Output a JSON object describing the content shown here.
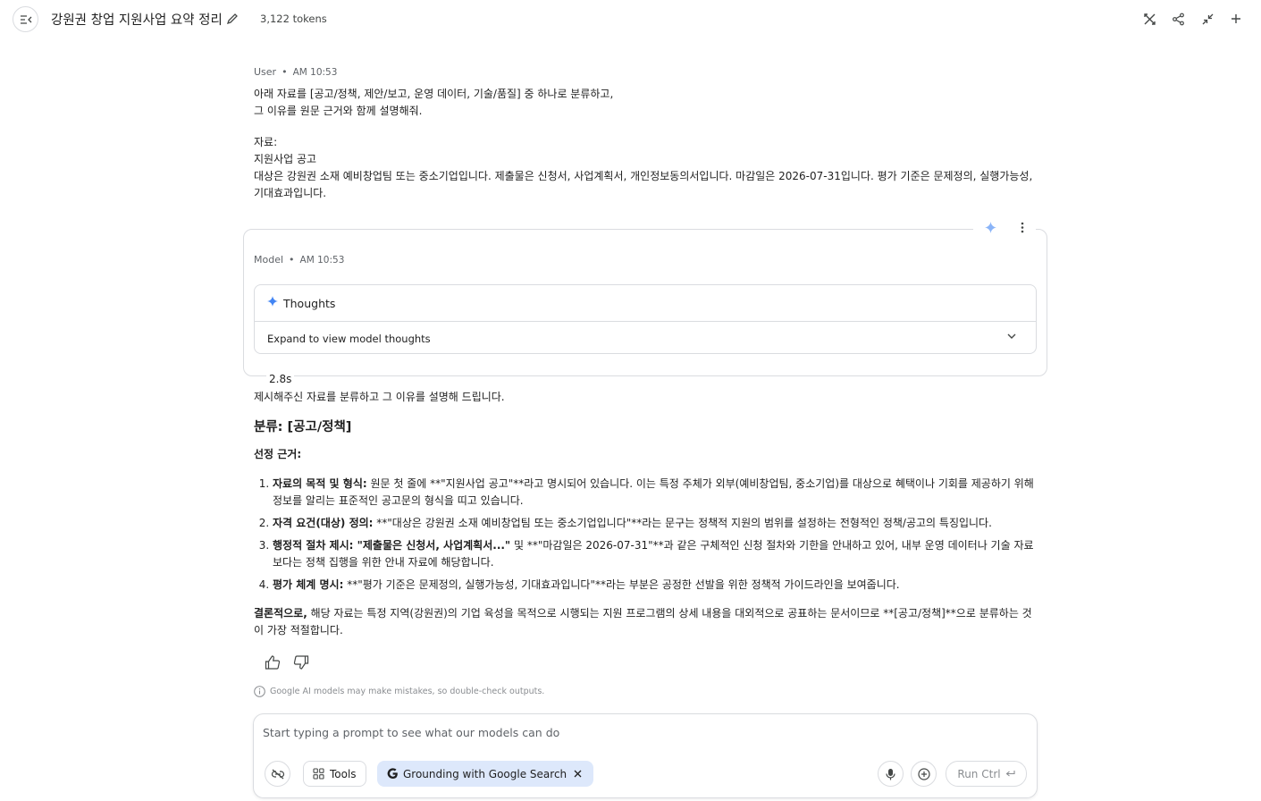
{
  "header": {
    "title": "강원권 창업 지원사업 요약 정리",
    "tokens": "3,122 tokens"
  },
  "user_message": {
    "author": "User",
    "time": "AM 10:53",
    "lines": [
      "아래 자료를 [공고/정책, 제안/보고, 운영 데이터, 기술/품질] 중 하나로 분류하고,\n그 이유를 원문 근거와 함께 설명해줘.",
      "자료:\n지원사업 공고\n대상은 강원권 소재 예비창업팀 또는 중소기업입니다. 제출물은 신청서, 사업계획서, 개인정보동의서입니다. 마감일은 2026-07-31입니다. 평가 기준은 문제정의, 실행가능성, 기대효과입니다."
    ]
  },
  "model_message": {
    "author": "Model",
    "time": "AM 10:53",
    "thoughts_label": "Thoughts",
    "thoughts_expand": "Expand to view model thoughts",
    "duration": "2.8s",
    "intro": "제시해주신 자료를 분류하고 그 이유를 설명해 드립니다.",
    "classification": "분류: [공고/정책]",
    "reason_heading": "선정 근거:",
    "reasons": [
      {
        "bold": "자료의 목적 및 형식:",
        "text": " 원문 첫 줄에 **\"지원사업 공고\"**라고 명시되어 있습니다. 이는 특정 주체가 외부(예비창업팀, 중소기업)를 대상으로 혜택이나 기회를 제공하기 위해 정보를 알리는 표준적인 공고문의 형식을 띠고 있습니다."
      },
      {
        "bold": "자격 요건(대상) 정의:",
        "text": " **\"대상은 강원권 소재 예비창업팀 또는 중소기업입니다\"**라는 문구는 정책적 지원의 범위를 설정하는 전형적인 정책/공고의 특징입니다."
      },
      {
        "bold": "행정적 절차 제시: \"제출물은 신청서, 사업계획서...\"",
        "text": " 및 **\"마감일은 2026-07-31\"**과 같은 구체적인 신청 절차와 기한을 안내하고 있어, 내부 운영 데이터나 기술 자료보다는 정책 집행을 위한 안내 자료에 해당합니다."
      },
      {
        "bold": "평가 체계 명시:",
        "text": " **\"평가 기준은 문제정의, 실행가능성, 기대효과입니다\"**라는 부분은 공정한 선발을 위한 정책적 가이드라인을 보여줍니다."
      }
    ],
    "conclusion_bold": "결론적으로,",
    "conclusion_text": " 해당 자료는 특정 지역(강원권)의 기업 육성을 목적으로 시행되는 지원 프로그램의 상세 내용을 대외적으로 공표하는 문서이므로 **[공고/정책]**으로 분류하는 것이 가장 적절합니다."
  },
  "disclaimer": "Google AI models may make mistakes, so double-check outputs.",
  "composer": {
    "placeholder": "Start typing a prompt to see what our models can do",
    "tools_label": "Tools",
    "grounding_label": "Grounding with Google Search",
    "run_label": "Run Ctrl"
  },
  "colors": {
    "accent_blue": "#4285f4",
    "chip_bg": "#dde8fb",
    "border": "#dadce0"
  },
  "icons": [
    "menu-collapse-icon",
    "pencil-icon",
    "compare-icon",
    "share-icon",
    "compress-icon",
    "plus-icon",
    "sparkle-icon",
    "more-vert-icon",
    "chevron-down-icon",
    "thumb-up-icon",
    "thumb-down-icon",
    "info-icon",
    "link-off-icon",
    "tools-icon",
    "google-g-icon",
    "close-icon",
    "mic-icon",
    "add-circle-icon",
    "enter-icon"
  ]
}
